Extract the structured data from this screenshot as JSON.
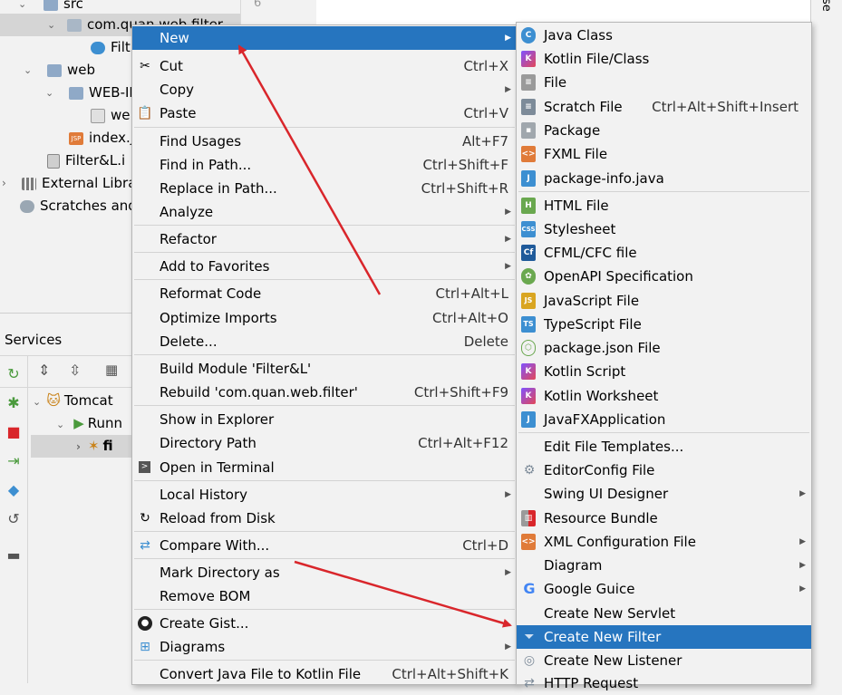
{
  "project_tree": {
    "items": [
      {
        "label": "src"
      },
      {
        "label": "com.quan.web.filter"
      },
      {
        "label": "Filt"
      },
      {
        "label": "web"
      },
      {
        "label": "WEB-IN"
      },
      {
        "label": "we"
      },
      {
        "label": "index.j"
      },
      {
        "label": "Filter&L.i"
      },
      {
        "label": "External Libra"
      },
      {
        "label": "Scratches and"
      }
    ]
  },
  "gutter": {
    "line_number": "6"
  },
  "right_stripe": {
    "label": "se"
  },
  "services": {
    "title": "Services",
    "tree": [
      {
        "label": "Tomcat"
      },
      {
        "label": "Runn"
      },
      {
        "label": "fi"
      }
    ]
  },
  "context_menu": {
    "items": [
      {
        "label": "New",
        "shortcut": "",
        "submenu": true
      },
      {
        "label": "Cut",
        "shortcut": "Ctrl+X"
      },
      {
        "label": "Copy",
        "shortcut": "",
        "submenu": true
      },
      {
        "label": "Paste",
        "shortcut": "Ctrl+V"
      },
      {
        "label": "Find Usages",
        "shortcut": "Alt+F7"
      },
      {
        "label": "Find in Path...",
        "shortcut": "Ctrl+Shift+F"
      },
      {
        "label": "Replace in Path...",
        "shortcut": "Ctrl+Shift+R"
      },
      {
        "label": "Analyze",
        "shortcut": "",
        "submenu": true
      },
      {
        "label": "Refactor",
        "shortcut": "",
        "submenu": true
      },
      {
        "label": "Add to Favorites",
        "shortcut": "",
        "submenu": true
      },
      {
        "label": "Reformat Code",
        "shortcut": "Ctrl+Alt+L"
      },
      {
        "label": "Optimize Imports",
        "shortcut": "Ctrl+Alt+O"
      },
      {
        "label": "Delete...",
        "shortcut": "Delete"
      },
      {
        "label": "Build Module 'Filter&L'",
        "shortcut": ""
      },
      {
        "label": "Rebuild 'com.quan.web.filter'",
        "shortcut": "Ctrl+Shift+F9"
      },
      {
        "label": "Show in Explorer",
        "shortcut": ""
      },
      {
        "label": "Directory Path",
        "shortcut": "Ctrl+Alt+F12"
      },
      {
        "label": "Open in Terminal",
        "shortcut": ""
      },
      {
        "label": "Local History",
        "shortcut": "",
        "submenu": true
      },
      {
        "label": "Reload from Disk",
        "shortcut": ""
      },
      {
        "label": "Compare With...",
        "shortcut": "Ctrl+D"
      },
      {
        "label": "Mark Directory as",
        "shortcut": "",
        "submenu": true
      },
      {
        "label": "Remove BOM",
        "shortcut": ""
      },
      {
        "label": "Create Gist...",
        "shortcut": ""
      },
      {
        "label": "Diagrams",
        "shortcut": "",
        "submenu": true
      },
      {
        "label": "Convert Java File to Kotlin File",
        "shortcut": "Ctrl+Alt+Shift+K"
      }
    ]
  },
  "new_submenu": {
    "items": [
      {
        "label": "Java Class",
        "shortcut": ""
      },
      {
        "label": "Kotlin File/Class",
        "shortcut": ""
      },
      {
        "label": "File",
        "shortcut": ""
      },
      {
        "label": "Scratch File",
        "shortcut": "Ctrl+Alt+Shift+Insert"
      },
      {
        "label": "Package",
        "shortcut": ""
      },
      {
        "label": "FXML File",
        "shortcut": ""
      },
      {
        "label": "package-info.java",
        "shortcut": ""
      },
      {
        "label": "HTML File",
        "shortcut": ""
      },
      {
        "label": "Stylesheet",
        "shortcut": ""
      },
      {
        "label": "CFML/CFC file",
        "shortcut": ""
      },
      {
        "label": "OpenAPI Specification",
        "shortcut": ""
      },
      {
        "label": "JavaScript File",
        "shortcut": ""
      },
      {
        "label": "TypeScript File",
        "shortcut": ""
      },
      {
        "label": "package.json File",
        "shortcut": ""
      },
      {
        "label": "Kotlin Script",
        "shortcut": ""
      },
      {
        "label": "Kotlin Worksheet",
        "shortcut": ""
      },
      {
        "label": "JavaFXApplication",
        "shortcut": ""
      },
      {
        "label": "Edit File Templates...",
        "shortcut": ""
      },
      {
        "label": "EditorConfig File",
        "shortcut": ""
      },
      {
        "label": "Swing UI Designer",
        "shortcut": "",
        "submenu": true
      },
      {
        "label": "Resource Bundle",
        "shortcut": ""
      },
      {
        "label": "XML Configuration File",
        "shortcut": "",
        "submenu": true
      },
      {
        "label": "Diagram",
        "shortcut": "",
        "submenu": true
      },
      {
        "label": "Google Guice",
        "shortcut": "",
        "submenu": true
      },
      {
        "label": "Create New Servlet",
        "shortcut": ""
      },
      {
        "label": "Create New Filter",
        "shortcut": ""
      },
      {
        "label": "Create New Listener",
        "shortcut": ""
      },
      {
        "label": "HTTP Request",
        "shortcut": ""
      }
    ]
  },
  "colors": {
    "highlight": "#2675bf",
    "annotation_arrow": "#d9262b",
    "menu_bg": "#f2f2f2"
  }
}
